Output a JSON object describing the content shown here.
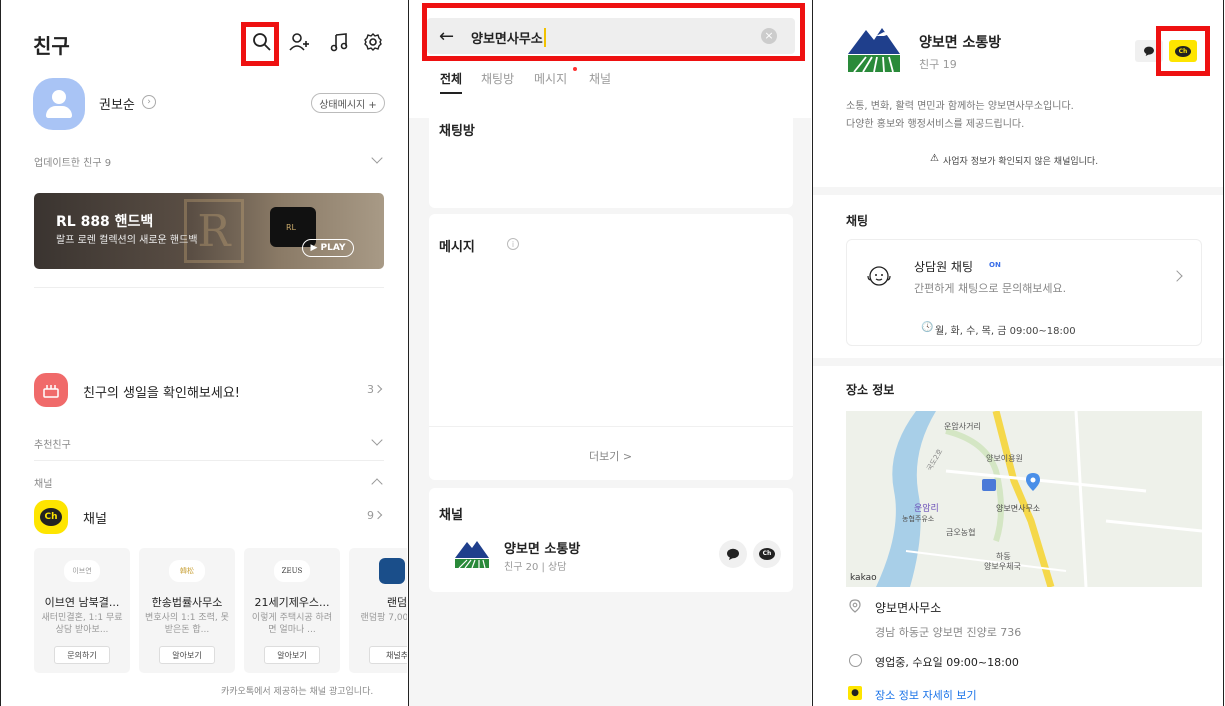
{
  "friends_panel": {
    "title": "친구",
    "profile_name": "권보순",
    "status_button": "상태메시지 +",
    "updated_friends": "업데이트한 친구 9",
    "banner": {
      "title": "RL 888 핸드백",
      "subtitle": "랄프 로렌 컬렉션의 새로운 핸드백",
      "play_label": "▶ PLAY",
      "badge": "RL"
    },
    "birthday_text": "친구의 생일을 확인해보세요!",
    "birthday_count": "3",
    "recommended_label": "추천친구",
    "channel_section_label": "채널",
    "channel_row_label": "채널",
    "channel_count": "9",
    "channel_cards": [
      {
        "logo": "이브연",
        "name": "이브연 남북결...",
        "desc": "새터민결혼, 1:1 무료상담 받아보...",
        "button": "문의하기"
      },
      {
        "logo": "韓松",
        "name": "한송법률사무소",
        "desc": "변호사의 1:1 조력, 못받은돈 합...",
        "button": "알아보기"
      },
      {
        "logo": "ZEUS",
        "name": "21세기제우스...",
        "desc": "이렇게 주택시공 하려면 얼마나 ...",
        "button": "알아보기"
      },
      {
        "logo": "",
        "name": "랜덤",
        "desc": "랜덤팡 7,000원 꽝",
        "button": "채널추"
      }
    ],
    "ad_notice": "카카오톡에서 제공하는 채널 광고입니다."
  },
  "search_panel": {
    "query": "양보면사무소",
    "tabs": [
      "전체",
      "채팅방",
      "메시지",
      "채널"
    ],
    "chatroom_section": "채팅방",
    "message_section": "메시지",
    "more_label": "더보기 >",
    "channel_section": "채널",
    "result_name": "양보면 소통방",
    "result_meta": "친구 20 | 상담"
  },
  "channel_panel": {
    "name": "양보면 소통방",
    "friends": "친구 19",
    "description_line1": "소통, 변화, 활력 면민과 함께하는 양보면사무소입니다.",
    "description_line2": "다양한 홍보와 행정서비스를 제공드립니다.",
    "warning": "사업자 정보가 확인되지 않은 채널입니다.",
    "chat_section": "채팅",
    "counselor_title": "상담원 채팅",
    "on_badge": "ON",
    "counselor_desc": "간편하게 채팅으로 문의해보세요.",
    "hours_label": "월, 화, 수, 목, 금 09:00~18:00",
    "place_section": "장소 정보",
    "map_labels": {
      "junction": "운암사거리",
      "barber": "양보이용원",
      "office": "양보면사무소",
      "village": "운암리",
      "gas": "농협주유소",
      "geumo": "금오농협",
      "post_top": "하동",
      "post": "양보우체국",
      "road": "국도2호",
      "provider": "kakao"
    },
    "place_name": "양보면사무소",
    "address": "경남 하동군 양보면 진양로 736",
    "open_status": "영업중, 수요일 09:00~18:00",
    "place_link": "장소 정보 자세히 보기"
  },
  "colors": {
    "highlight_box": "#ee1111",
    "kakao_yellow": "#fee500",
    "avatar_blue": "#a9c4f5",
    "birthday_red": "#f06a6a",
    "link_blue": "#1a73e8"
  },
  "icons": [
    "search-icon",
    "add-friend-icon",
    "music-icon",
    "settings-icon",
    "back-arrow-icon",
    "clear-icon",
    "chat-bubble-icon",
    "channel-plus-icon",
    "clock-icon",
    "location-pin-icon",
    "warning-icon",
    "info-icon",
    "cake-icon",
    "chevron-down-icon",
    "chevron-right-icon"
  ]
}
